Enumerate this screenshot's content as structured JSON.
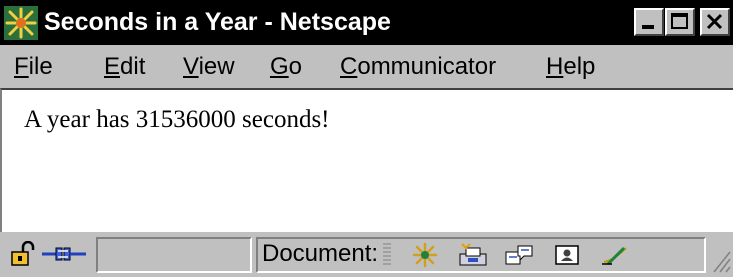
{
  "window": {
    "title": "Seconds in a Year - Netscape",
    "app_icon": "netscape-logo-icon",
    "controls": {
      "minimize_icon": "minimize-icon",
      "maximize_icon": "maximize-icon",
      "close_icon": "close-icon"
    }
  },
  "menubar": {
    "items": [
      {
        "label": "File",
        "mnemonic": "F",
        "rest": "ile"
      },
      {
        "label": "Edit",
        "mnemonic": "E",
        "rest": "dit"
      },
      {
        "label": "View",
        "mnemonic": "V",
        "rest": "iew"
      },
      {
        "label": "Go",
        "mnemonic": "G",
        "rest": "o"
      },
      {
        "label": "Communicator",
        "mnemonic": "C",
        "rest": "ommunicator"
      },
      {
        "label": "Help",
        "mnemonic": "H",
        "rest": "elp"
      }
    ]
  },
  "content": {
    "text": "A year has 31536000 seconds!"
  },
  "statusbar": {
    "security_icon": "unlocked-padlock-icon",
    "connection_icon": "online-connection-icon",
    "status_text": "",
    "document_label": "Document:",
    "component_icons": [
      "navigator-icon",
      "inbox-icon",
      "discussions-icon",
      "address-book-icon",
      "composer-icon"
    ],
    "resize_icon": "resize-grip-icon"
  },
  "colors": {
    "titlebar_bg": "#000000",
    "chrome": "#c0c0c0",
    "content_bg": "#ffffff"
  }
}
